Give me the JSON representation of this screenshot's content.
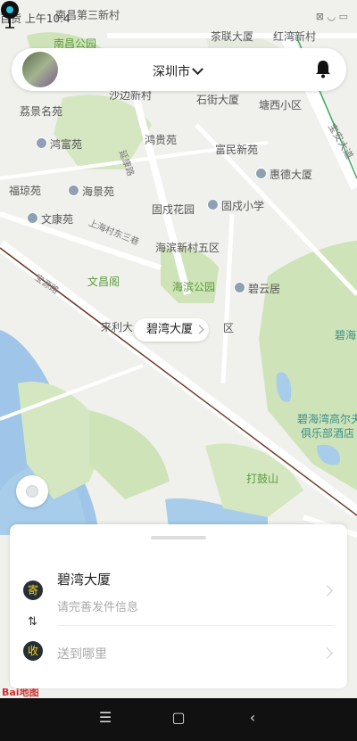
{
  "status": {
    "left": "百货  上午10:4",
    "right_icons": "wifi battery"
  },
  "header": {
    "city": "深圳市",
    "bell_icon": "bell-icon",
    "avatar_icon": "avatar"
  },
  "map": {
    "labels": [
      "南昌第三新村",
      "南昌公园",
      "茶联大厦",
      "红湾新村",
      "沙边新村",
      "石街大厦",
      "塘西小区",
      "荔景名苑",
      "鸿贵苑",
      "富民新苑",
      "鸿富苑",
      "惠德大厦",
      "福琼苑",
      "海景苑",
      "固戍花园",
      "固戍小学",
      "文康苑",
      "海滨新村五区",
      "文昌阁",
      "海滨公园",
      "碧云居",
      "来利大",
      "区",
      "碧海湾高尔夫",
      "俱乐部酒店",
      "打鼓山",
      "碧海",
      "上海村东三巷",
      "宝源路",
      "延康路",
      "宝安大道"
    ]
  },
  "pin": {
    "label": "碧湾大厦"
  },
  "sheet": {
    "send_badge": "寄",
    "recv_badge": "收",
    "swap_symbol": "⇅",
    "sender_title": "碧湾大厦",
    "sender_sub": "请完善发件信息",
    "destination_placeholder": "送到哪里"
  },
  "footer": {
    "logo": "Bai地图"
  },
  "navbar": {
    "menu": "☰",
    "home": "▢",
    "back": "‹"
  }
}
